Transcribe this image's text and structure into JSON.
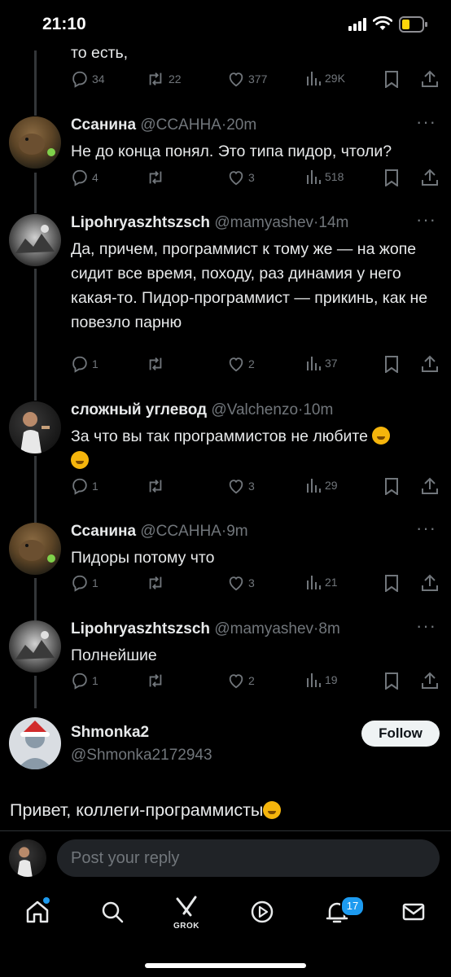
{
  "status_bar": {
    "time": "21:10",
    "icons": [
      "signal-icon",
      "wifi-icon",
      "battery-icon"
    ],
    "battery_color": "#ffd60a"
  },
  "top_partial_tweet": {
    "text": "то есть,",
    "actions": {
      "replies": "34",
      "retweets": "22",
      "likes": "377",
      "views": "29K"
    }
  },
  "tweets": [
    {
      "name": "Ссанина",
      "handle": "@CCAHHA",
      "time": "20m",
      "text": "Не до конца понял. Это типа пидор, чтоли?",
      "actions": {
        "replies": "4",
        "retweets": "",
        "likes": "3",
        "views": "518"
      }
    },
    {
      "name": "Lipohryaszhtszsch",
      "handle": "@mamyashev",
      "time": "14m",
      "text": "Да, причем, программист к тому же — на жопе сидит все время, походу, раз динамия у него какая-то. Пидор-программист — прикинь, как не повезло парню",
      "actions": {
        "replies": "1",
        "retweets": "",
        "likes": "2",
        "views": "37"
      }
    },
    {
      "name": "сложный углевод",
      "handle": "@Valchenzo",
      "time": "10m",
      "text": "За что вы так программистов не любите",
      "actions": {
        "replies": "1",
        "retweets": "",
        "likes": "3",
        "views": "29"
      }
    },
    {
      "name": "Ссанина",
      "handle": "@CCAHHA",
      "time": "9m",
      "text": "Пидоры потому что",
      "actions": {
        "replies": "1",
        "retweets": "",
        "likes": "3",
        "views": "21"
      }
    },
    {
      "name": "Lipohryaszhtszsch",
      "handle": "@mamyashev",
      "time": "8m",
      "text": "Полнейшие",
      "actions": {
        "replies": "1",
        "retweets": "",
        "likes": "2",
        "views": "19"
      }
    }
  ],
  "op": {
    "name": "Shmonka2",
    "handle": "@Shmonka2172943",
    "follow_label": "Follow",
    "text": "Привет, коллеги-программисты"
  },
  "reply": {
    "placeholder": "Post your reply"
  },
  "nav": {
    "grok_label": "GROK",
    "notifications_count": "17",
    "accent": "#1d9bf0"
  },
  "colors": {
    "background": "#000000",
    "secondary_text": "#71767b",
    "divider": "#2f3336"
  }
}
